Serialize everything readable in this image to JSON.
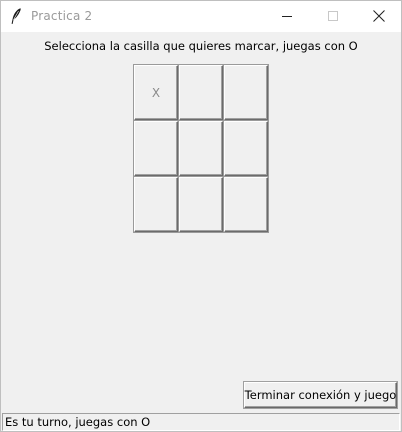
{
  "window": {
    "title": "Practica 2",
    "icons": {
      "app": "feather-icon",
      "minimize": "minimize-icon",
      "maximize": "maximize-icon",
      "close": "close-icon"
    }
  },
  "instruction": "Selecciona la casilla que quieres marcar, juegas con O",
  "board": {
    "cells": [
      "X",
      "",
      "",
      "",
      "",
      "",
      "",
      "",
      ""
    ]
  },
  "end_button": "Terminar conexión y juego",
  "status": "Es tu turno, juegas con O"
}
